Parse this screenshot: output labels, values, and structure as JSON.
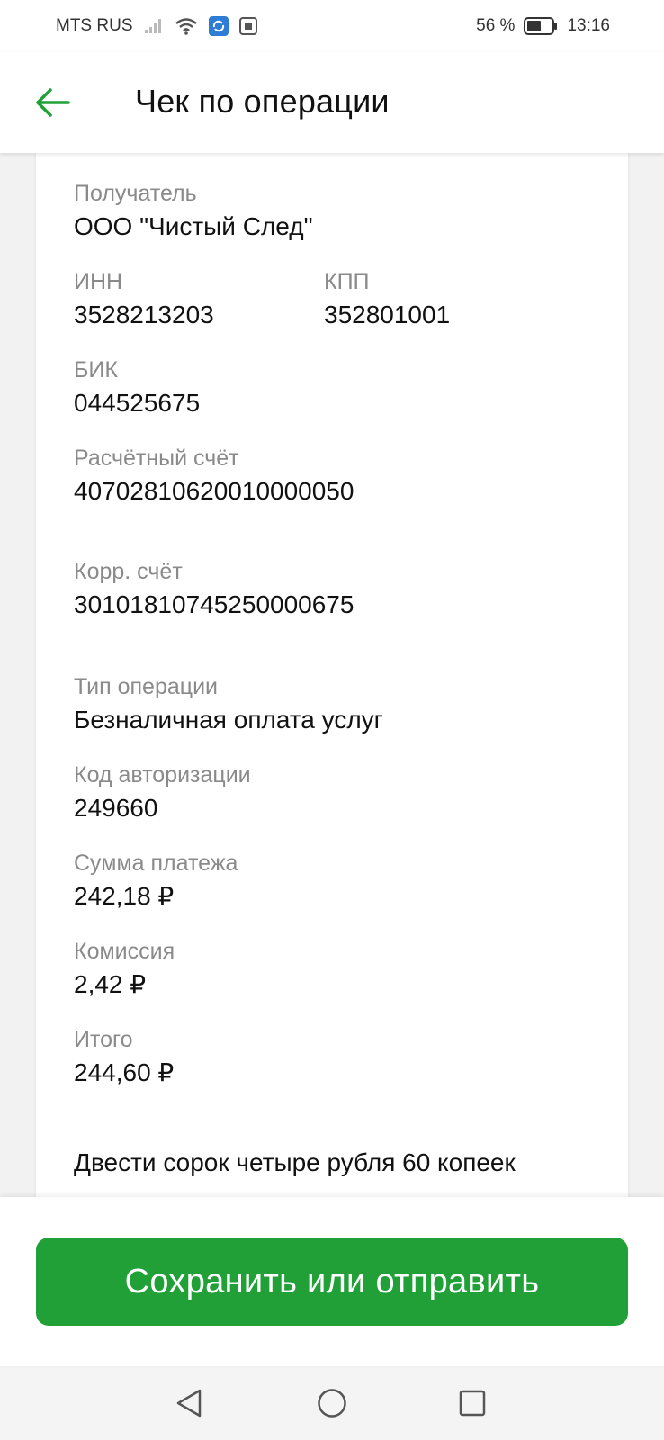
{
  "status_bar": {
    "carrier": "MTS RUS",
    "battery": "56 %",
    "time": "13:16"
  },
  "header": {
    "title": "Чек по операции"
  },
  "receipt": {
    "recipient_label": "Получатель",
    "recipient_value": "ООО \"Чистый След\"",
    "inn_label": "ИНН",
    "inn_value": "3528213203",
    "kpp_label": "КПП",
    "kpp_value": "352801001",
    "bik_label": "БИК",
    "bik_value": "044525675",
    "account_label": "Расчётный счёт",
    "account_value": "40702810620010000050",
    "corr_label": "Корр. счёт",
    "corr_value": "30101810745250000675",
    "op_type_label": "Тип операции",
    "op_type_value": "Безналичная оплата услуг",
    "auth_label": "Код авторизации",
    "auth_value": "249660",
    "amount_label": "Сумма платежа",
    "amount_value": "242,18 ₽",
    "fee_label": "Комиссия",
    "fee_value": "2,42 ₽",
    "total_label": "Итого",
    "total_value": "244,60 ₽",
    "total_words": "Двести сорок четыре рубля 60 копеек"
  },
  "actions": {
    "save_label": "Сохранить или отправить"
  },
  "colors": {
    "accent": "#21a038"
  }
}
